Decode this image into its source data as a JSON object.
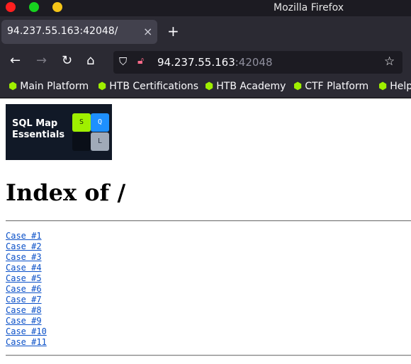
{
  "window": {
    "title": "Mozilla Firefox"
  },
  "tab": {
    "title": "94.237.55.163:42048/",
    "close": "×",
    "new_tab": "+"
  },
  "nav": {
    "url_host": "94.237.55.163",
    "url_port": ":42048"
  },
  "bookmarks": [
    "Main Platform",
    "HTB Certifications",
    "HTB Academy",
    "CTF Platform",
    "Help"
  ],
  "banner": {
    "line1": "SQL Map",
    "line2": "Essentials",
    "s": "S",
    "q": "Q",
    "l": "L"
  },
  "page": {
    "heading": "Index of /",
    "links": [
      "Case #1",
      "Case #2",
      "Case #3",
      "Case #4",
      "Case #5",
      "Case #6",
      "Case #7",
      "Case #8",
      "Case #9",
      "Case #10",
      "Case #11"
    ]
  }
}
